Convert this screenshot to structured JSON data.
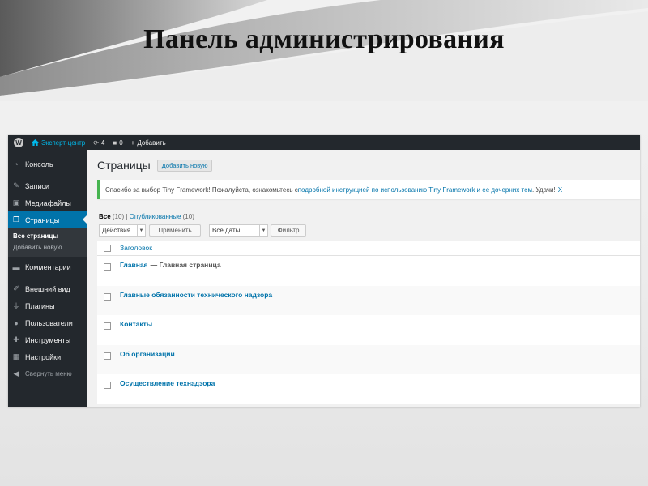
{
  "slide": {
    "title": "Панель администрирования"
  },
  "admin_bar": {
    "logo_icon": "wordpress-logo-icon",
    "site_name": "Эксперт-центр",
    "updates_count": "4",
    "comments_count": "0",
    "new_label": "Добавить"
  },
  "sidebar": {
    "items": [
      {
        "label": "Консоль",
        "icon": "dashboard-icon"
      },
      {
        "label": "Записи",
        "icon": "pin-icon"
      },
      {
        "label": "Медиафайлы",
        "icon": "media-icon"
      },
      {
        "label": "Страницы",
        "icon": "pages-icon",
        "active": true
      },
      {
        "label": "Комментарии",
        "icon": "comment-icon"
      },
      {
        "label": "Внешний вид",
        "icon": "brush-icon"
      },
      {
        "label": "Плагины",
        "icon": "plug-icon"
      },
      {
        "label": "Пользователи",
        "icon": "user-icon"
      },
      {
        "label": "Инструменты",
        "icon": "wrench-icon"
      },
      {
        "label": "Настройки",
        "icon": "settings-icon"
      }
    ],
    "submenu": [
      "Все страницы",
      "Добавить новую"
    ],
    "collapse_label": "Свернуть меню"
  },
  "main": {
    "page_title": "Страницы",
    "add_new_label": "Добавить новую",
    "notice": {
      "text_before": "Спасибо за выбор Tiny Framework! Пожалуйста, ознакомьтесь с ",
      "link": "подробной инструкцией по использованию Tiny Framework и ее дочерних тем",
      "text_after": ". Удачи! ",
      "dismiss": "X"
    },
    "filters": {
      "all_label": "Все",
      "all_count": "(10)",
      "separator": "|",
      "published_label": "Опубликованные",
      "published_count": "(10)"
    },
    "bulk_actions": "Действия",
    "apply_label": "Применить",
    "dates_label": "Все даты",
    "filter_label": "Фильтр",
    "column_title": "Заголовок",
    "rows": [
      {
        "title": "Главная",
        "state": "— Главная страница"
      },
      {
        "title": "Главные обязанности технического надзора",
        "state": ""
      },
      {
        "title": "Контакты",
        "state": ""
      },
      {
        "title": "Об организации",
        "state": ""
      },
      {
        "title": "Осуществление технадзора",
        "state": ""
      }
    ]
  }
}
